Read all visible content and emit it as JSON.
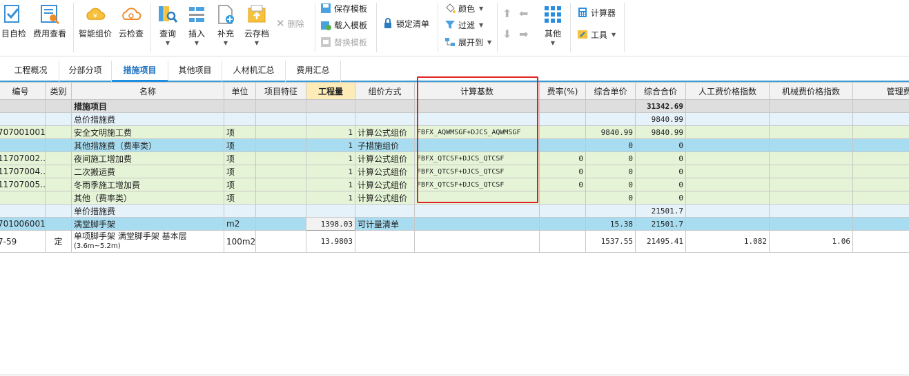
{
  "ribbon": {
    "self_check": "目自检",
    "fee_view": "费用查看",
    "smart_price": "智能组价",
    "cloud_check": "云检查",
    "query": "查询",
    "insert": "插入",
    "supplement": "补充",
    "cloud_save": "云存档",
    "delete": "删除",
    "save_template": "保存模板",
    "load_template": "载入模板",
    "replace_template": "替换模板",
    "lock_list": "锁定清单",
    "color": "颜色",
    "filter": "过滤",
    "expand_to": "展开到",
    "other": "其他",
    "calculator": "计算器",
    "tools": "工具"
  },
  "tabs": [
    "工程概况",
    "分部分项",
    "措施项目",
    "其他项目",
    "人材机汇总",
    "费用汇总"
  ],
  "active_tab": "措施项目",
  "columns": [
    "编号",
    "类别",
    "名称",
    "单位",
    "项目特征",
    "工程量",
    "组价方式",
    "计算基数",
    "费率(%)",
    "综合单价",
    "综合合价",
    "人工费价格指数",
    "机械费价格指数",
    "管理费价格"
  ],
  "rows": [
    {
      "code": "",
      "type": "",
      "name": "措施项目",
      "unit": "",
      "feature": "",
      "qty": "",
      "method": "",
      "base": "",
      "rate": "",
      "unit_price": "",
      "total": "31342.69",
      "labor_idx": "",
      "mach_idx": "",
      "mgmt_idx": ""
    },
    {
      "code": "",
      "type": "",
      "name": "总价措施费",
      "unit": "",
      "feature": "",
      "qty": "",
      "method": "",
      "base": "",
      "rate": "",
      "unit_price": "",
      "total": "9840.99",
      "labor_idx": "",
      "mach_idx": "",
      "mgmt_idx": ""
    },
    {
      "code": "707001001",
      "type": "",
      "name": "安全文明施工费",
      "unit": "项",
      "feature": "",
      "qty": "1",
      "method": "计算公式组价",
      "base": "FBFX_AQWMSGF+DJCS_AQWMSGF",
      "rate": "",
      "unit_price": "9840.99",
      "total": "9840.99",
      "labor_idx": "",
      "mach_idx": "",
      "mgmt_idx": ""
    },
    {
      "code": "",
      "type": "",
      "name": "其他措施费（费率类）",
      "unit": "项",
      "feature": "",
      "qty": "1",
      "method": "子措施组价",
      "base": "",
      "rate": "",
      "unit_price": "0",
      "total": "0",
      "labor_idx": "",
      "mach_idx": "",
      "mgmt_idx": ""
    },
    {
      "code": "11707002…",
      "type": "",
      "name": "夜间施工增加费",
      "unit": "项",
      "feature": "",
      "qty": "1",
      "method": "计算公式组价",
      "base": "FBFX_QTCSF+DJCS_QTCSF",
      "rate": "0",
      "unit_price": "0",
      "total": "0",
      "labor_idx": "",
      "mach_idx": "",
      "mgmt_idx": ""
    },
    {
      "code": "11707004…",
      "type": "",
      "name": "二次搬运费",
      "unit": "项",
      "feature": "",
      "qty": "1",
      "method": "计算公式组价",
      "base": "FBFX_QTCSF+DJCS_QTCSF",
      "rate": "0",
      "unit_price": "0",
      "total": "0",
      "labor_idx": "",
      "mach_idx": "",
      "mgmt_idx": ""
    },
    {
      "code": "11707005…",
      "type": "",
      "name": "冬雨季施工增加费",
      "unit": "项",
      "feature": "",
      "qty": "1",
      "method": "计算公式组价",
      "base": "FBFX_QTCSF+DJCS_QTCSF",
      "rate": "0",
      "unit_price": "0",
      "total": "0",
      "labor_idx": "",
      "mach_idx": "",
      "mgmt_idx": ""
    },
    {
      "code": "",
      "type": "",
      "name": "其他（费率类）",
      "unit": "项",
      "feature": "",
      "qty": "1",
      "method": "计算公式组价",
      "base": "",
      "rate": "",
      "unit_price": "0",
      "total": "0",
      "labor_idx": "",
      "mach_idx": "",
      "mgmt_idx": ""
    },
    {
      "code": "",
      "type": "",
      "name": "单价措施费",
      "unit": "",
      "feature": "",
      "qty": "",
      "method": "",
      "base": "",
      "rate": "",
      "unit_price": "",
      "total": "21501.7",
      "labor_idx": "",
      "mach_idx": "",
      "mgmt_idx": ""
    },
    {
      "code": "701006001",
      "type": "",
      "name": "满堂脚手架",
      "unit": "m2",
      "feature": "",
      "qty": "1398.03",
      "method": "可计量清单",
      "base": "",
      "rate": "",
      "unit_price": "15.38",
      "total": "21501.7",
      "labor_idx": "",
      "mach_idx": "",
      "mgmt_idx": ""
    },
    {
      "code": "7-59",
      "type": "定",
      "name": "单项脚手架 满堂脚手架 基本层",
      "name2": "(3.6m~5.2m)",
      "unit": "100m2",
      "feature": "",
      "qty": "13.9803",
      "method": "",
      "base": "",
      "rate": "",
      "unit_price": "1537.55",
      "total": "21495.41",
      "labor_idx": "1.082",
      "mach_idx": "1.06",
      "mgmt_idx": ""
    }
  ],
  "colors": {
    "accent": "#1e8ee0",
    "highlight_box": "#e02020",
    "item_row": "#e5f4d6",
    "selected_row": "#a8dcf0"
  }
}
